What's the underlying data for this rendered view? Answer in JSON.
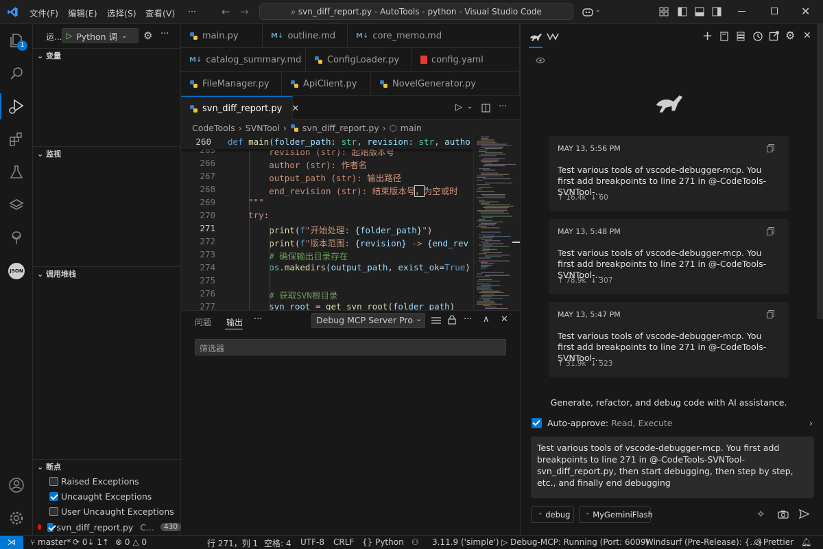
{
  "titlebar": {
    "menus": [
      "文件(F)",
      "编辑(E)",
      "选择(S)",
      "查看(V)",
      "···"
    ],
    "command_center": "svn_diff_report.py - AutoTools - python - Visual Studio Code"
  },
  "activity": {
    "badge": "1",
    "json_label": "JSON"
  },
  "sidebar": {
    "run_title": "运...",
    "run_config": "Python 调",
    "sections": {
      "variables": "变量",
      "watch": "监视",
      "callstack": "调用堆栈",
      "breakpoints": "断点"
    },
    "breakpoints": [
      {
        "label": "Raised Exceptions",
        "checked": false
      },
      {
        "label": "Uncaught Exceptions",
        "checked": true
      },
      {
        "label": "User Uncaught Exceptions",
        "checked": false
      }
    ],
    "bp_file": {
      "name": "svn_diff_report.py",
      "dir": "C...",
      "line": "430"
    }
  },
  "tabs": {
    "row1": [
      "main.py",
      "outline.md",
      "core_memo.md"
    ],
    "row2": [
      "catalog_summary.md",
      "ConfigLoader.py",
      "config.yaml"
    ],
    "row3": [
      "FileManager.py",
      "ApiClient.py",
      "NovelGenerator.py"
    ],
    "active": "svn_diff_report.py"
  },
  "breadcrumb": [
    "CodeTools",
    "SVNTool",
    "svn_diff_report.py",
    "main"
  ],
  "editor": {
    "sticky_line": "260",
    "line_numbers": [
      "265",
      "266",
      "267",
      "268",
      "269",
      "270",
      "271",
      "272",
      "273",
      "274",
      "275",
      "276",
      "277"
    ]
  },
  "panel": {
    "tabs": [
      "问题",
      "输出"
    ],
    "output_source": "Debug MCP Server Proc",
    "filter_placeholder": "筛选器"
  },
  "chat": {
    "cards": [
      {
        "date": "MAY 13, 5:56 PM",
        "text": "Test various tools of vscode-debugger-mcp. You first add breakpoints to line 271 in @-CodeTools-SVNTool-...",
        "up": "↑ 16.4k",
        "down": "↓ 60"
      },
      {
        "date": "MAY 13, 5:48 PM",
        "text": "Test various tools of vscode-debugger-mcp. You first add breakpoints to line 271 in @-CodeTools-SVNTool-...",
        "up": "↑ 78.9k",
        "down": "↓ 307"
      },
      {
        "date": "MAY 13, 5:47 PM",
        "text": "Test various tools of vscode-debugger-mcp. You first add breakpoints to line 271 in @-CodeTools-SVNTool-...",
        "up": "↑ 31.9k",
        "down": "↓ 523"
      }
    ],
    "tagline": "Generate, refactor, and debug code with AI assistance.",
    "auto_approve_label": "Auto-approve:",
    "auto_approve_value": "Read, Execute",
    "input_text": "Test various tools of vscode-debugger-mcp. You first add breakpoints to line 271 in @-CodeTools-SVNTool-svn_diff_report.py, then start debugging, then step by step, etc., and finally end debugging",
    "mode": "debug",
    "model": "MyGeminiFlash"
  },
  "status": {
    "branch": "master*",
    "sync": "0↓ 1↑",
    "errors": "0",
    "warnings": "0",
    "position": "行 271，列 1",
    "spaces": "空格: 4",
    "encoding": "UTF-8",
    "eol": "CRLF",
    "language": "Python",
    "interpreter": "3.11.9 ('simple')",
    "debug": "Debug-MCP: Running (Port: 6009)",
    "windsurf": "Windsurf (Pre-Release): {...}",
    "prettier": "Prettier"
  }
}
